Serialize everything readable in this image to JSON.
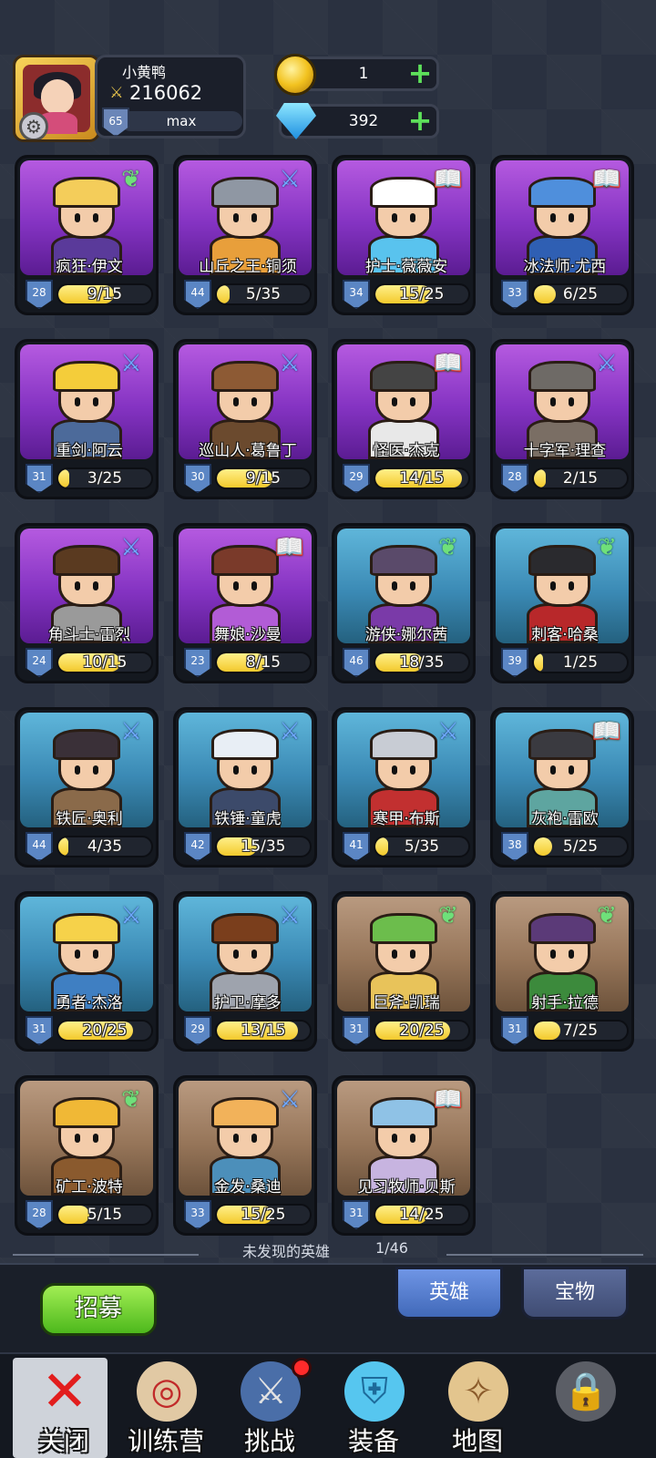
{
  "player": {
    "name": "小黄鸭",
    "power": "216062",
    "level": "65",
    "level_status": "max"
  },
  "currencies": {
    "gold": "1",
    "gems": "392"
  },
  "heroes": [
    {
      "name": "疯狂·伊文",
      "level": "28",
      "progress": "9/15",
      "fill": 0.6,
      "class": "wing",
      "bg": "purple",
      "hat": "#f4cd5a",
      "body": "#5a3a9a"
    },
    {
      "name": "山丘之王·铜须",
      "level": "44",
      "progress": "5/35",
      "fill": 0.14,
      "class": "sword",
      "bg": "purple",
      "hat": "#8f97a3",
      "body": "#e89f3b"
    },
    {
      "name": "护士·薇薇安",
      "level": "34",
      "progress": "15/25",
      "fill": 0.6,
      "class": "book",
      "bg": "purple",
      "hat": "#ffffff",
      "body": "#59c3ee"
    },
    {
      "name": "冰法师·尤西",
      "level": "33",
      "progress": "6/25",
      "fill": 0.24,
      "class": "book",
      "bg": "purple",
      "hat": "#4f8fdc",
      "body": "#2f5fb3"
    },
    {
      "name": "重剑·阿云",
      "level": "31",
      "progress": "3/25",
      "fill": 0.12,
      "class": "sword",
      "bg": "purple",
      "hat": "#f4cd3a",
      "body": "#4c6a9a"
    },
    {
      "name": "巡山人·葛鲁丁",
      "level": "30",
      "progress": "9/15",
      "fill": 0.6,
      "class": "sword",
      "bg": "purple",
      "hat": "#8d5a34",
      "body": "#6b4a2e"
    },
    {
      "name": "怪医·杰克",
      "level": "29",
      "progress": "14/15",
      "fill": 0.93,
      "class": "book",
      "bg": "purple",
      "hat": "#444444",
      "body": "#e8e8e8"
    },
    {
      "name": "十字军·理查",
      "level": "28",
      "progress": "2/15",
      "fill": 0.13,
      "class": "sword",
      "bg": "purple",
      "hat": "#6e6a66",
      "body": "#7a6e64"
    },
    {
      "name": "角斗士·雷烈",
      "level": "24",
      "progress": "10/15",
      "fill": 0.67,
      "class": "sword",
      "bg": "purple",
      "hat": "#5a3a20",
      "body": "#9a9a9a"
    },
    {
      "name": "舞娘·沙曼",
      "level": "23",
      "progress": "8/15",
      "fill": 0.53,
      "class": "book",
      "bg": "purple",
      "hat": "#7a3a2a",
      "body": "#b25cd6"
    },
    {
      "name": "游侠·娜尔茜",
      "level": "46",
      "progress": "18/35",
      "fill": 0.51,
      "class": "wing",
      "bg": "teal",
      "hat": "#5a4a6a",
      "body": "#7a3aa8"
    },
    {
      "name": "刺客·哈桑",
      "level": "39",
      "progress": "1/25",
      "fill": 0.04,
      "class": "wing",
      "bg": "teal",
      "hat": "#2a2a2e",
      "body": "#b8282a"
    },
    {
      "name": "铁匠·奥利",
      "level": "44",
      "progress": "4/35",
      "fill": 0.11,
      "class": "sword",
      "bg": "teal",
      "hat": "#3a3038",
      "body": "#8a6a4a"
    },
    {
      "name": "铁锤·童虎",
      "level": "42",
      "progress": "15/35",
      "fill": 0.43,
      "class": "sword",
      "bg": "teal",
      "hat": "#e8eef5",
      "body": "#3c4a6a"
    },
    {
      "name": "寒甲·布斯",
      "level": "41",
      "progress": "5/35",
      "fill": 0.14,
      "class": "sword",
      "bg": "teal",
      "hat": "#c8ccd4",
      "body": "#c23030"
    },
    {
      "name": "灰袍·雷欧",
      "level": "38",
      "progress": "5/25",
      "fill": 0.2,
      "class": "book",
      "bg": "teal",
      "hat": "#3a3a40",
      "body": "#5ea5a0"
    },
    {
      "name": "勇者·杰洛",
      "level": "31",
      "progress": "20/25",
      "fill": 0.8,
      "class": "sword",
      "bg": "teal",
      "hat": "#f6d24a",
      "body": "#3f7fc2"
    },
    {
      "name": "护卫·摩多",
      "level": "29",
      "progress": "13/15",
      "fill": 0.87,
      "class": "sword",
      "bg": "teal",
      "hat": "#7a3e1c",
      "body": "#9ea3ad"
    },
    {
      "name": "巨斧·凯瑞",
      "level": "31",
      "progress": "20/25",
      "fill": 0.8,
      "class": "wing",
      "bg": "brown",
      "hat": "#6cbd4c",
      "body": "#e8c35a"
    },
    {
      "name": "射手·拉德",
      "level": "31",
      "progress": "7/25",
      "fill": 0.28,
      "class": "wing",
      "bg": "brown",
      "hat": "#5b3a78",
      "body": "#3c8a3c"
    },
    {
      "name": "矿工·波特",
      "level": "28",
      "progress": "5/15",
      "fill": 0.33,
      "class": "wing",
      "bg": "brown",
      "hat": "#f0b836",
      "body": "#8a5a2e"
    },
    {
      "name": "金发·桑迪",
      "level": "33",
      "progress": "15/25",
      "fill": 0.6,
      "class": "sword",
      "bg": "brown",
      "hat": "#f2b25a",
      "body": "#4c8fba"
    },
    {
      "name": "见习牧师·贝斯",
      "level": "31",
      "progress": "14/25",
      "fill": 0.56,
      "class": "book",
      "bg": "brown",
      "hat": "#8fc2e6",
      "body": "#c7b4e0"
    }
  ],
  "undiscovered": {
    "label": "未发现的英雄",
    "count": "1/46"
  },
  "actions": {
    "recruit": "招募",
    "tab_heroes": "英雄",
    "tab_treasure": "宝物"
  },
  "nav": {
    "close": "关闭",
    "training": "训练营",
    "challenge": "挑战",
    "equipment": "装备",
    "map": "地图"
  },
  "icons": {
    "sword": "⚔",
    "book": "📖",
    "wing": "❦"
  },
  "colors": {
    "progress_fill": "#f3c92c",
    "plus": "#5de05a",
    "recruit": "#4db81c",
    "tab_active": "#4169b9"
  }
}
